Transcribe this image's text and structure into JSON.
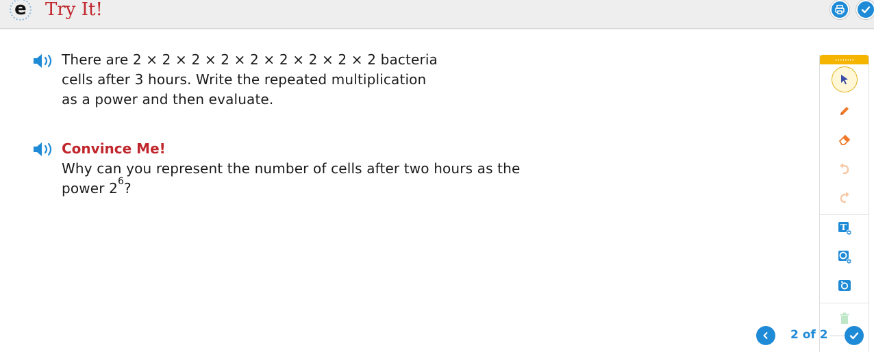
{
  "header": {
    "title": "Try It!",
    "logo_letter": "e",
    "buttons": [
      {
        "name": "print-button",
        "icon": "printer-icon"
      },
      {
        "name": "check-button",
        "icon": "check-icon"
      }
    ]
  },
  "content": {
    "problem_lines": [
      "There are 2 × 2 × 2 × 2 × 2 × 2 × 2 × 2 × 2 bacteria",
      "cells after 3 hours. Write the repeated multiplication",
      "as a power and then evaluate."
    ],
    "convince": {
      "heading": "Convince Me!",
      "line1": "Why can you represent the number of cells after two hours as the",
      "line2_prefix": "power 2",
      "line2_exponent": "6",
      "line2_suffix": "?"
    }
  },
  "toolbar": {
    "tools": [
      "select-tool",
      "pen-tool",
      "eraser-tool",
      "undo-tool",
      "redo-tool",
      "text-tool",
      "shape-tool",
      "camera-tool",
      "delete-tool"
    ]
  },
  "footer": {
    "page_counter": "2 of 2"
  },
  "colors": {
    "brand_red": "#c0272d",
    "accent_blue": "#1f8ad6",
    "orange": "#f07a2a",
    "toolbar_yellow": "#f5b400"
  }
}
